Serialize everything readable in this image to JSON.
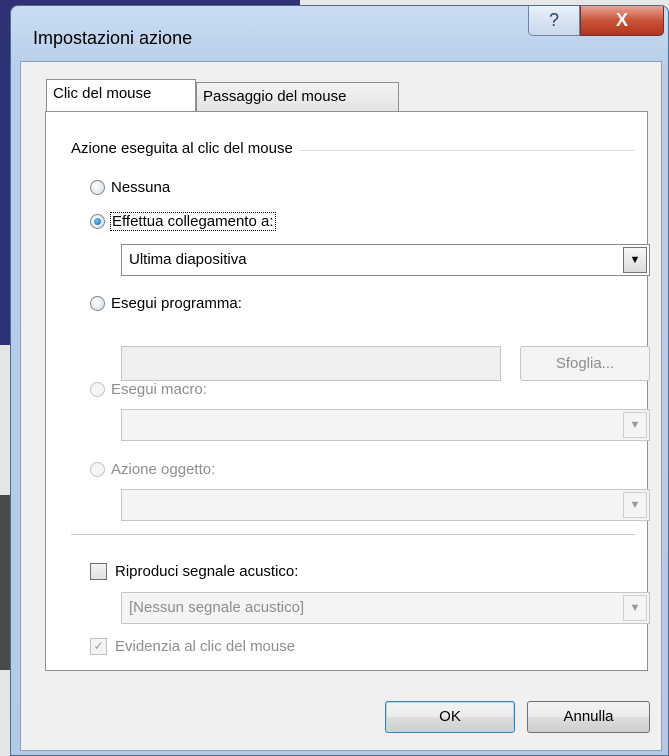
{
  "dialog": {
    "title": "Impostazioni azione",
    "help_glyph": "?",
    "close_glyph": "X"
  },
  "tabs": [
    {
      "label": "Clic del mouse"
    },
    {
      "label": "Passaggio del mouse"
    }
  ],
  "group": {
    "label": "Azione eseguita al clic del mouse"
  },
  "options": {
    "none": {
      "label": "Nessuna",
      "selected": false
    },
    "link": {
      "label": "Effettua collegamento a:",
      "selected": true,
      "value": "Ultima diapositiva"
    },
    "program": {
      "label": "Esegui programma:",
      "selected": false,
      "value": "",
      "browse_label": "Sfoglia..."
    },
    "macro": {
      "label": "Esegui macro:",
      "enabled": false,
      "value": ""
    },
    "object_action": {
      "label": "Azione oggetto:",
      "enabled": false,
      "value": ""
    }
  },
  "sound": {
    "label": "Riproduci segnale acustico:",
    "checked": false,
    "value": "[Nessun segnale acustico]"
  },
  "highlight": {
    "label": "Evidenzia al clic del mouse",
    "checked": true,
    "enabled": false
  },
  "buttons": {
    "ok": "OK",
    "cancel": "Annulla"
  }
}
